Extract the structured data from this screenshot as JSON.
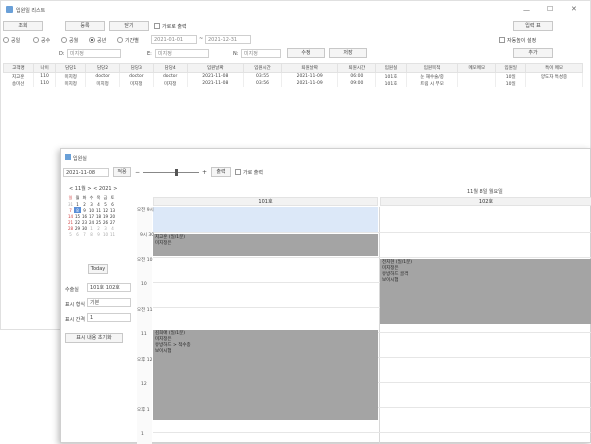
{
  "window": {
    "title": "입원일 리스트",
    "controls": [
      "—",
      "☐",
      "✕"
    ]
  },
  "toolbar": {
    "search": "조회",
    "register": "등록",
    "close": "닫기",
    "hide_deleted": "가로로 출력",
    "print": "입력 표",
    "auto_settings": "자동높이 설정",
    "add": "추가",
    "modify": "수정",
    "save": "저장"
  },
  "filters": {
    "radios": [
      "공일",
      "공수",
      "공월",
      "공년",
      "기간별"
    ],
    "selected_radio": 3,
    "date_from": "2021-01-01",
    "date_to": "2021-12-31",
    "a_label": "D:",
    "a_value": "미지정",
    "b_label": "E:",
    "b_value": "미지정",
    "c_label": "N:",
    "c_value": "미지정"
  },
  "table": {
    "columns": [
      "고객명",
      "나이",
      "담당1",
      "담당2",
      "담당3",
      "담당4",
      "입원날짜",
      "입원시간",
      "퇴원날짜",
      "퇴원시간",
      "입원실",
      "입원목적",
      "메모메모",
      "입원일",
      "특이 메모"
    ],
    "rows": [
      [
        "지고훈",
        "110",
        "미지정",
        "doctor",
        "doctor",
        "doctor",
        "2021-11-08",
        "03:55",
        "2021-11-09",
        "06:00",
        "101호",
        "눈 재수술/중",
        "",
        "10일",
        "양도자 특성중"
      ],
      [
        "송미선",
        "110",
        "미지정",
        "미지정",
        "미지정",
        "미지정",
        "2021-11-08",
        "03:56",
        "2021-11-09",
        "09:00",
        "101호",
        "트림 시 부모",
        "",
        "10일",
        ""
      ]
    ]
  },
  "scheduler": {
    "title": "입원실",
    "date": "2021-11-08",
    "today_btn": "적용",
    "view_btn": "출력",
    "show_all": "가로 출력",
    "month_label": "< 11월 > < 2021 >",
    "weekdays": [
      "일",
      "월",
      "화",
      "수",
      "목",
      "금",
      "토"
    ],
    "calendar_rows": [
      [
        "31",
        "1",
        "2",
        "3",
        "4",
        "5",
        "6"
      ],
      [
        "7",
        "8",
        "9",
        "10",
        "11",
        "12",
        "13"
      ],
      [
        "14",
        "15",
        "16",
        "17",
        "18",
        "19",
        "20"
      ],
      [
        "21",
        "22",
        "23",
        "24",
        "25",
        "26",
        "27"
      ],
      [
        "28",
        "29",
        "30",
        "1",
        "2",
        "3",
        "4"
      ],
      [
        "5",
        "6",
        "7",
        "8",
        "9",
        "10",
        "11"
      ]
    ],
    "today_button": "Today",
    "room_label": "수술실",
    "room_value": "101호 102호",
    "display_label": "표시 형식",
    "display_value": "기본",
    "interval_label": "표시 간격",
    "interval_value": "1",
    "reset_btn": "표시 내용 초기화",
    "header_top": "11월 8일 월요일",
    "col1": "101호",
    "col2": "102호",
    "side_labels": [
      "오전 9시",
      "9시 30",
      "오전 10",
      "10",
      "오전 11",
      "11",
      "오후 12",
      "12",
      "오후 1",
      "1"
    ],
    "events": [
      {
        "title": "지고훈 (일/1분)",
        "sub": "미지정은"
      },
      {
        "title": "전지현 (일/1분)",
        "sub": "미지정은",
        "line3": "유방하드 골격",
        "line4": "보이시험"
      },
      {
        "title": "김희애 (일/1분)",
        "sub": "미지정은",
        "line3": "유방하드 > 적수종",
        "line4": "보이시험"
      }
    ]
  },
  "colors": {
    "event_bg": "#a4a4a4",
    "selected_cell": "#dce8f8",
    "highlight_blue": "#5a8fd8",
    "calendar_red": "#d04040"
  }
}
